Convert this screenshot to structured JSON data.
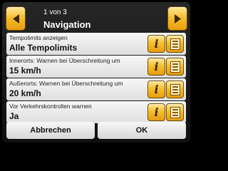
{
  "header": {
    "page_indicator": "1 von 3",
    "title": "Navigation",
    "prev_icon": "arrow-left-icon",
    "next_icon": "arrow-right-icon"
  },
  "settings": [
    {
      "label": "Tempolimits anzeigen",
      "value": "Alle Tempolimits"
    },
    {
      "label": "Innerorts: Warnen bei Überschreitung um",
      "value": "15 km/h"
    },
    {
      "label": "Außerorts: Warnen bei Überschreitung um",
      "value": "20 km/h"
    },
    {
      "label": "Vor Verkehrskontrollen warnen",
      "value": "Ja"
    }
  ],
  "row_buttons": {
    "info_glyph": "i",
    "info_icon": "info-icon",
    "list_icon": "list-icon"
  },
  "footer": {
    "cancel_label": "Abbrechen",
    "ok_label": "OK"
  },
  "colors": {
    "accent": "#f5bd2b",
    "background": "#1a1a1a",
    "row": "#ececec"
  }
}
